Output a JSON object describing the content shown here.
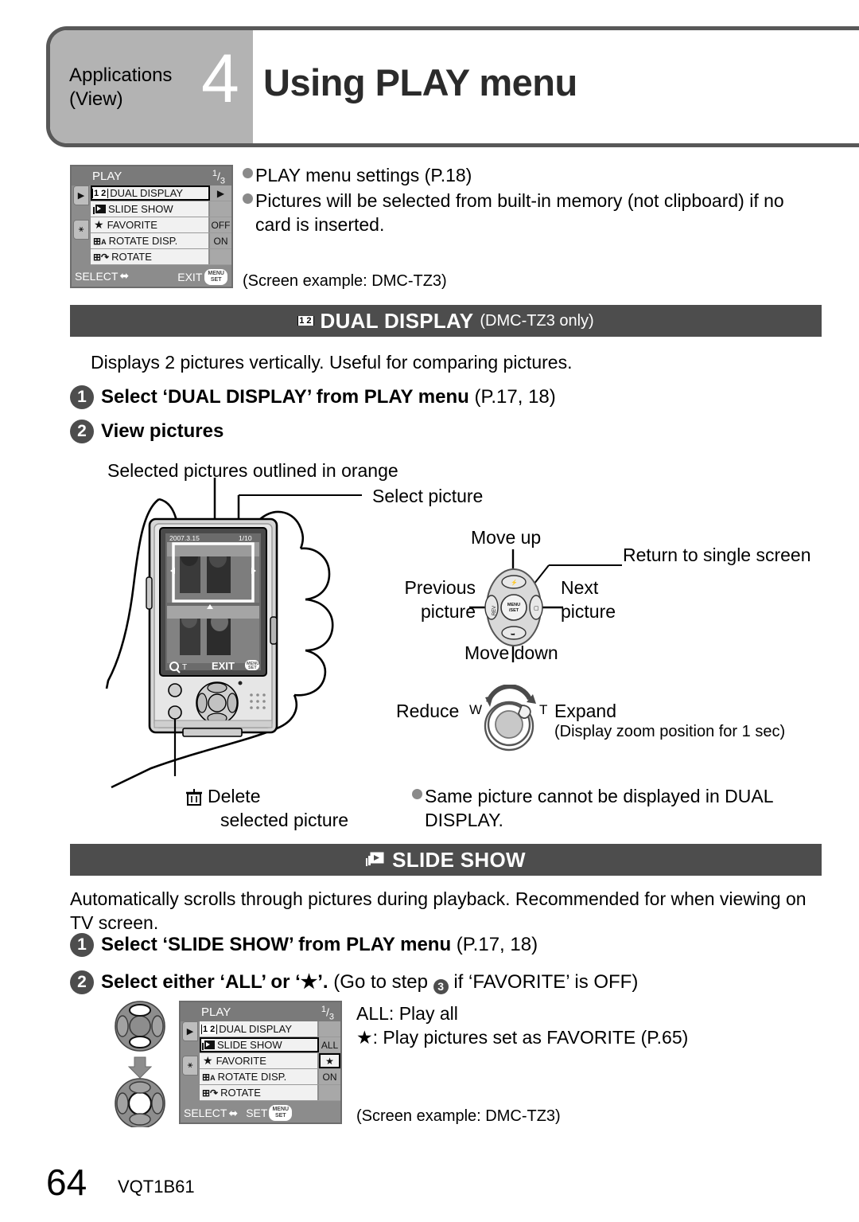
{
  "header": {
    "applications_line1": "Applications",
    "applications_line2": "(View)",
    "chapter_number": "4",
    "title": "Using PLAY menu"
  },
  "top_menu": {
    "title": "PLAY",
    "page_current": "1",
    "page_total": "3",
    "tab_play_icon": "playback-icon",
    "tab_setup_icon": "wrench-icon",
    "rows": [
      {
        "icon": "dual-display-icon",
        "label": "DUAL DISPLAY",
        "value": "",
        "selected": true,
        "arrow": "▶"
      },
      {
        "icon": "slide-show-icon",
        "label": "SLIDE SHOW",
        "value": "",
        "selected": false,
        "arrow": ""
      },
      {
        "icon": "star-icon",
        "label": "FAVORITE",
        "value": "OFF",
        "selected": false,
        "arrow": ""
      },
      {
        "icon": "rotate-disp-icon",
        "label": "ROTATE DISP.",
        "value": "ON",
        "selected": false,
        "arrow": ""
      },
      {
        "icon": "rotate-icon",
        "label": "ROTATE",
        "value": "",
        "selected": false,
        "arrow": ""
      }
    ],
    "footer_left": "SELECT",
    "footer_right": "EXIT",
    "footer_badge_top": "MENU",
    "footer_badge_bottom": "SET"
  },
  "top_notes": {
    "bullet1": "PLAY menu settings (P.18)",
    "bullet2": "Pictures will be selected from built-in memory (not clipboard) if no card is inserted.",
    "screen_example": "(Screen example: DMC-TZ3)"
  },
  "dual_display": {
    "bar_icon": "dual-display-icon",
    "bar_title": "DUAL DISPLAY",
    "bar_subtitle": "(DMC-TZ3 only)",
    "description": "Displays 2 pictures vertically. Useful for comparing pictures.",
    "step1_num": "1",
    "step1_bold": "Select ‘DUAL DISPLAY’ from PLAY menu",
    "step1_norm": " (P.17, 18)",
    "step2_num": "2",
    "step2_bold": "View pictures",
    "callout_orange": "Selected pictures outlined in orange",
    "callout_select_picture": "Select picture",
    "callout_move_up": "Move up",
    "callout_move_down": "Move down",
    "callout_previous_l1": "Previous",
    "callout_previous_l2": "picture",
    "callout_next_l1": "Next",
    "callout_next_l2": "picture",
    "callout_return": "Return to single screen",
    "callout_reduce": "Reduce",
    "callout_expand": "Expand",
    "callout_w": "W",
    "callout_t": "T",
    "callout_zoom_note": "(Display zoom position for 1 sec)",
    "callout_delete_l1": "Delete",
    "callout_delete_l2": "selected picture",
    "delete_icon": "trash-icon",
    "note_bullet": "Same picture cannot be displayed in DUAL DISPLAY.",
    "lcd": {
      "date": "2007.3.15",
      "counter": "1/10",
      "zoom_label": "T",
      "exit_label": "EXIT",
      "badge_top": "MENU",
      "badge_bottom": "SET"
    },
    "cursor_pad": {
      "up_icon": "flash-icon",
      "left_icon": "rev-icon",
      "right_icon": "exposure-icon",
      "down_icon": "macro-icon",
      "center_top": "MENU",
      "center_bottom": "SET"
    }
  },
  "slide_show": {
    "bar_icon": "slide-show-icon",
    "bar_title": "SLIDE SHOW",
    "description": "Automatically scrolls through pictures during playback. Recommended for when viewing on TV screen.",
    "step1_num": "1",
    "step1_bold": "Select ‘SLIDE SHOW’ from PLAY menu",
    "step1_norm": " (P.17, 18)",
    "step2_num": "2",
    "step2_bold_a": "Select either ‘ALL’ or ‘",
    "step2_bold_star": "★",
    "step2_bold_b": "’.",
    "step2_norm_a": " (Go to step ",
    "step2_inline_num": "3",
    "step2_norm_b": " if ‘FAVORITE’ is OFF)",
    "legend_all": "ALL: Play all",
    "legend_star": "★: Play pictures set as FAVORITE (P.65)",
    "screen_example": "(Screen example: DMC-TZ3)",
    "menu": {
      "title": "PLAY",
      "page_current": "1",
      "page_total": "3",
      "rows": [
        {
          "icon": "dual-display-icon",
          "label": "DUAL DISPLAY",
          "value": "",
          "selected": false
        },
        {
          "icon": "slide-show-icon",
          "label": "SLIDE SHOW",
          "value": "ALL",
          "selected": true
        },
        {
          "icon": "star-icon",
          "label": "FAVORITE",
          "value": "★",
          "selected": false,
          "value_selected": true
        },
        {
          "icon": "rotate-disp-icon",
          "label": "ROTATE DISP.",
          "value": "ON",
          "selected": false
        },
        {
          "icon": "rotate-icon",
          "label": "ROTATE",
          "value": "",
          "selected": false
        }
      ],
      "footer_left": "SELECT",
      "footer_right": "SET",
      "footer_badge_top": "MENU",
      "footer_badge_bottom": "SET"
    }
  },
  "footer": {
    "page_number": "64",
    "doc_code": "VQT1B61"
  },
  "colors": {
    "section_bar": "#4d4d4d",
    "header_grey": "#b3b3b3",
    "bullet_dot": "#8a8a8a"
  }
}
